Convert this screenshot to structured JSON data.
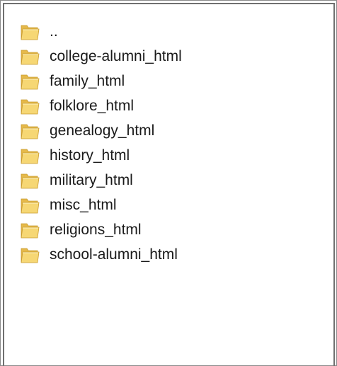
{
  "folder_list": {
    "items": [
      {
        "label": "..",
        "icon": "folder-icon"
      },
      {
        "label": "college-alumni_html",
        "icon": "folder-icon"
      },
      {
        "label": "family_html",
        "icon": "folder-icon"
      },
      {
        "label": "folklore_html",
        "icon": "folder-icon"
      },
      {
        "label": "genealogy_html",
        "icon": "folder-icon"
      },
      {
        "label": "history_html",
        "icon": "folder-icon"
      },
      {
        "label": "military_html",
        "icon": "folder-icon"
      },
      {
        "label": "misc_html",
        "icon": "folder-icon"
      },
      {
        "label": "religions_html",
        "icon": "folder-icon"
      },
      {
        "label": "school-alumni_html",
        "icon": "folder-icon"
      }
    ]
  },
  "colors": {
    "folder_back": "#e5b94a",
    "folder_front": "#f6d774",
    "folder_shadow": "#c89a2e",
    "text": "#1a1a1a",
    "border": "#707070"
  }
}
